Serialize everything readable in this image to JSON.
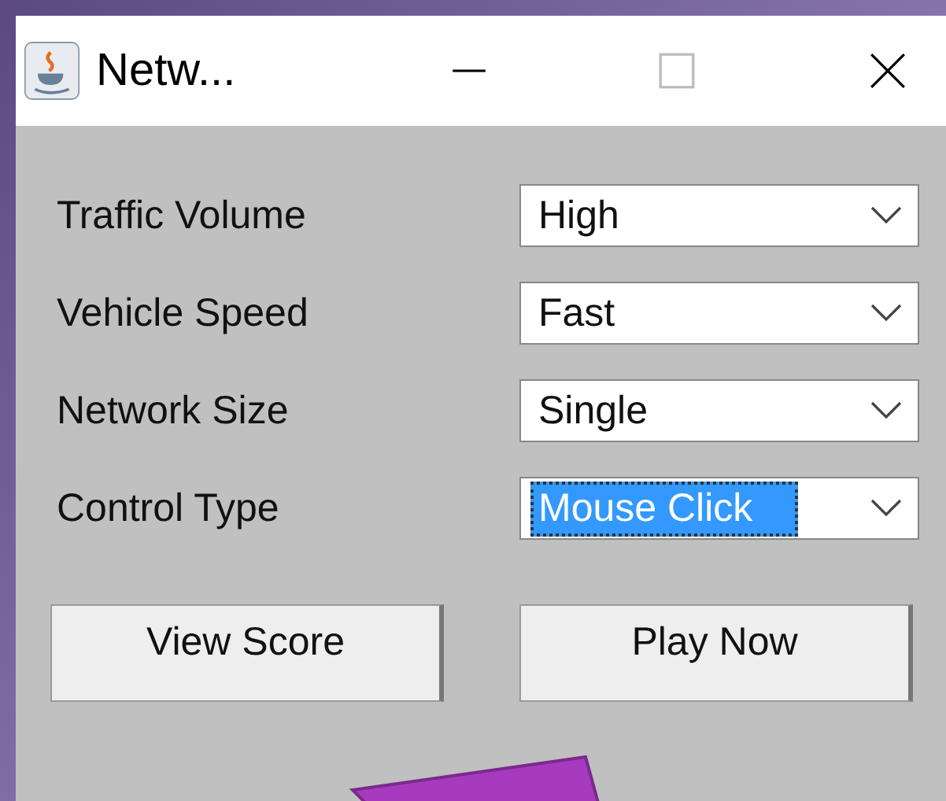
{
  "window": {
    "title": "Netw..."
  },
  "settings": [
    {
      "label": "Traffic Volume",
      "value": "High",
      "focused": false
    },
    {
      "label": "Vehicle Speed",
      "value": "Fast",
      "focused": false
    },
    {
      "label": "Network Size",
      "value": "Single",
      "focused": false
    },
    {
      "label": "Control Type",
      "value": "Mouse Click",
      "focused": true
    }
  ],
  "buttons": [
    "View Score",
    "Play Now"
  ]
}
